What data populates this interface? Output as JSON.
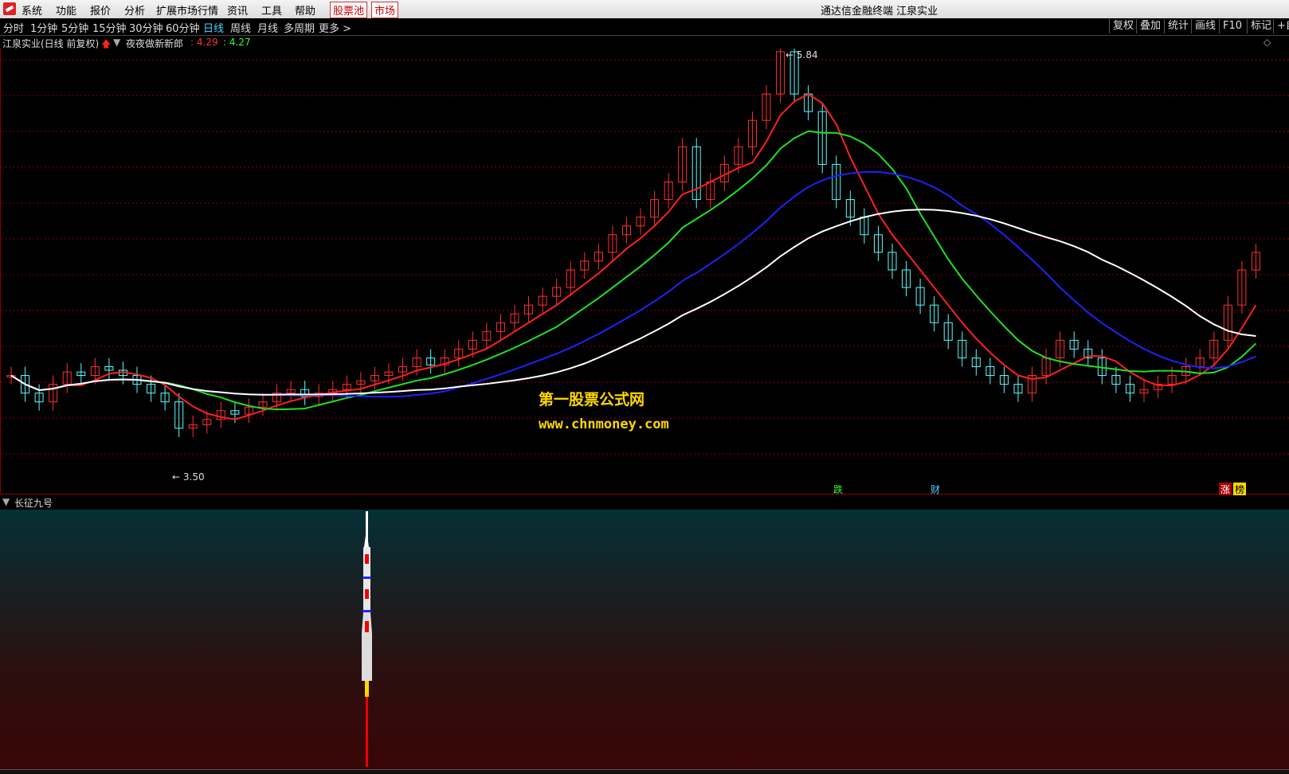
{
  "menubar": {
    "items": [
      "系统",
      "功能",
      "报价",
      "分析",
      "扩展市场行情",
      "资讯",
      "工具",
      "帮助"
    ],
    "boxed_items": [
      "股票池",
      "市场"
    ],
    "window_title": "通达信金融终端 江泉实业"
  },
  "toolbar": {
    "periods": [
      "分时",
      "1分钟",
      "5分钟",
      "15分钟",
      "30分钟",
      "60分钟",
      "日线",
      "周线",
      "月线",
      "多周期",
      "更多 >"
    ],
    "active_period": "日线",
    "right_buttons": [
      "复权",
      "叠加",
      "统计",
      "画线",
      "F10",
      "标记",
      "+自"
    ]
  },
  "infobar": {
    "stock_label": "江泉实业(日线 前复权)",
    "indicator_name": "夜夜做新新郎",
    "value1": ": 4.29",
    "value2": ": 4.27"
  },
  "chart_markers": {
    "high_label": "5.84",
    "low_label": "3.50",
    "tags": [
      "跌",
      "财",
      "涨",
      "榜"
    ]
  },
  "subchart": {
    "indicator_name": "长征九号"
  },
  "watermark": {
    "line1": "第一股票公式网",
    "line2": "www.chnmoney.com"
  },
  "colors": {
    "up": "#ff3030",
    "down": "#54ffff",
    "ma_red": "#ff2020",
    "ma_green": "#20e020",
    "ma_blue": "#2020ff",
    "ma_white": "#ffffff",
    "grid": "#8b0000",
    "highlight": "#ffd700"
  }
}
